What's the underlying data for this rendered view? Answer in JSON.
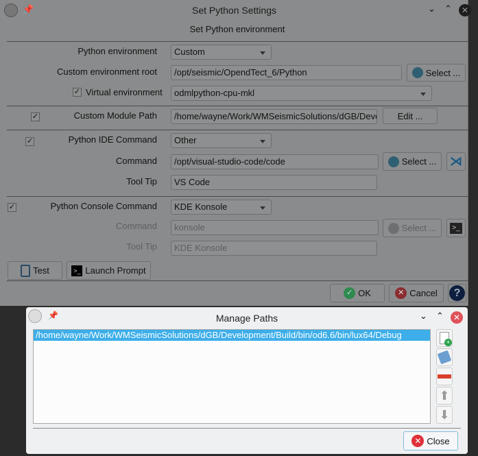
{
  "main": {
    "title": "Set Python Settings",
    "subtitle": "Set Python environment",
    "env_label": "Python environment",
    "env_value": "Custom",
    "root_label": "Custom environment root",
    "root_value": "/opt/seismic/OpendTect_6/Python",
    "select_label": "Select ...",
    "venv_label": "Virtual environment",
    "venv_checked": true,
    "venv_value": "odmlpython-cpu-mkl",
    "module_label": "Custom Module Path",
    "module_value": "/home/wayne/Work/WMSeismicSolutions/dGB/Deve",
    "edit_label": "Edit ...",
    "ide_label": "Python IDE Command",
    "ide_value": "Other",
    "ide_cmd_label": "Command",
    "ide_cmd_value": "/opt/visual-studio-code/code",
    "ide_tip_label": "Tool Tip",
    "ide_tip_value": "VS Code",
    "console_label": "Python Console Command",
    "console_value": "KDE Konsole",
    "con_cmd_label": "Command",
    "con_cmd_value": "konsole",
    "con_tip_label": "Tool Tip",
    "con_tip_value": "KDE Konsole",
    "test_label": "Test",
    "launch_label": "Launch Prompt",
    "ok_label": "OK",
    "cancel_label": "Cancel",
    "check": "✓"
  },
  "paths": {
    "title": "Manage Paths",
    "items": [
      "/home/wayne/Work/WMSeismicSolutions/dGB/Development/Build/bin/od6.6/bin/lux64/Debug"
    ],
    "close_label": "Close",
    "selection_color": "#3daee9"
  }
}
